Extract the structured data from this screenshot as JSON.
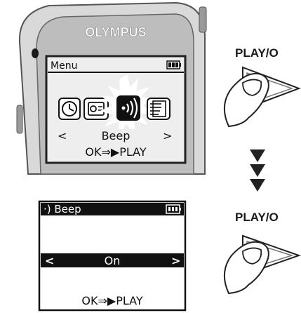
{
  "device": {
    "brand": "OLYMPUS",
    "screen": {
      "title": "Menu",
      "selected_item": "Beep",
      "nav_left": "<",
      "nav_right": ">",
      "hint": "OK⇒▶PLAY"
    }
  },
  "step_labels": {
    "top_button": "PLAY/O",
    "bottom_button": "PLAY/O"
  },
  "detail_screen": {
    "title": "·) Beep",
    "value": "On",
    "nav_left": "<",
    "nav_right": ">",
    "hint": "OK⇒▶PLAY"
  }
}
